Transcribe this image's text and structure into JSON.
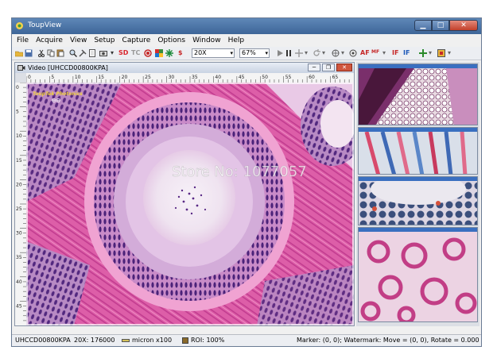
{
  "app": {
    "title": "ToupView"
  },
  "menu": [
    "File",
    "Acquire",
    "View",
    "Setup",
    "Capture",
    "Options",
    "Window",
    "Help"
  ],
  "toolbar": {
    "sd_label": "SD",
    "tc_label": "TC",
    "dollar_label": "$",
    "magnification": "20X",
    "zoom": "67%",
    "af_label": "AF",
    "mf_label": "MF",
    "if_label": "IF",
    "if2_label": "IF"
  },
  "video": {
    "title": "Video [UHCCD00800KPA]",
    "ruler_top_labels": [
      "0",
      "5",
      "10",
      "15",
      "20",
      "25",
      "30",
      "35",
      "40",
      "45",
      "50",
      "55",
      "60",
      "65"
    ],
    "ruler_left_labels": [
      "0",
      "5",
      "10",
      "15",
      "20",
      "25",
      "30",
      "35",
      "40",
      "45"
    ],
    "watermark": "Store No: 1077057",
    "logo_text": "ToupTek Photonics",
    "logo_sub": "ΘΘ"
  },
  "statusbar": {
    "camera": "UHCCD00800KPA",
    "mag": "20X: 176000",
    "scale": "micron x100",
    "roi": "ROI: 100%",
    "marker": "Marker: (0, 0); Watermark: Move = (0, 0), Rotate = 0.000"
  },
  "colors": {
    "titlebar": "#4a74a8",
    "tissue_pink": "#d85aa6",
    "nuclei_purple": "#5a2a86",
    "lumen": "#f4eef5"
  }
}
